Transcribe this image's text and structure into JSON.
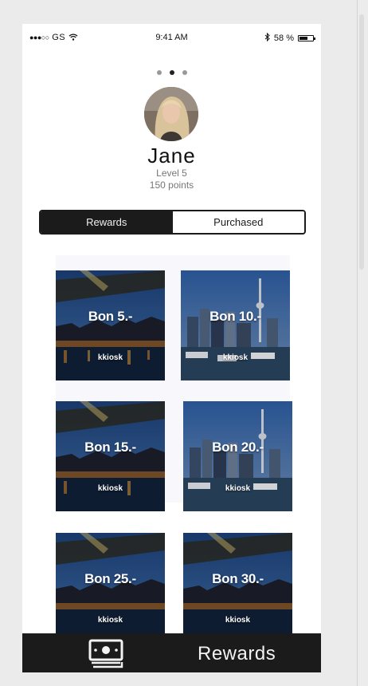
{
  "status_bar": {
    "signal_dots": "●●●○○",
    "carrier": "GS",
    "time": "9:41 AM",
    "battery_percent": "58 %",
    "icons": [
      "wifi-icon",
      "bluetooth-icon",
      "battery-icon"
    ]
  },
  "pager": {
    "pages": 3,
    "active_index": 1
  },
  "profile": {
    "name": "Jane",
    "level": "Level 5",
    "points": "150 points"
  },
  "segment": {
    "tabs": [
      "Rewards",
      "Purchased"
    ],
    "active": "Rewards"
  },
  "rewards": [
    {
      "title": "Bon 5.-",
      "vendor": "kkiosk",
      "image": "city-bridge-night"
    },
    {
      "title": "Bon 10.-",
      "vendor": "kkiosk",
      "image": "skyline-harbor"
    },
    {
      "title": "Bon 15.-",
      "vendor": "kkiosk",
      "image": "city-bridge-night"
    },
    {
      "title": "Bon 20.-",
      "vendor": "kkiosk",
      "image": "skyline-harbor"
    },
    {
      "title": "Bon 25.-",
      "vendor": "kkiosk",
      "image": "city-bridge-night"
    },
    {
      "title": "Bon 30.-",
      "vendor": "kkiosk",
      "image": "city-bridge-night"
    }
  ],
  "tab_bar": {
    "label": "Rewards",
    "icon": "money-icon"
  },
  "colors": {
    "dark": "#1b1b1b",
    "background": "#ebebeb",
    "accent_text": "#ffffff"
  }
}
